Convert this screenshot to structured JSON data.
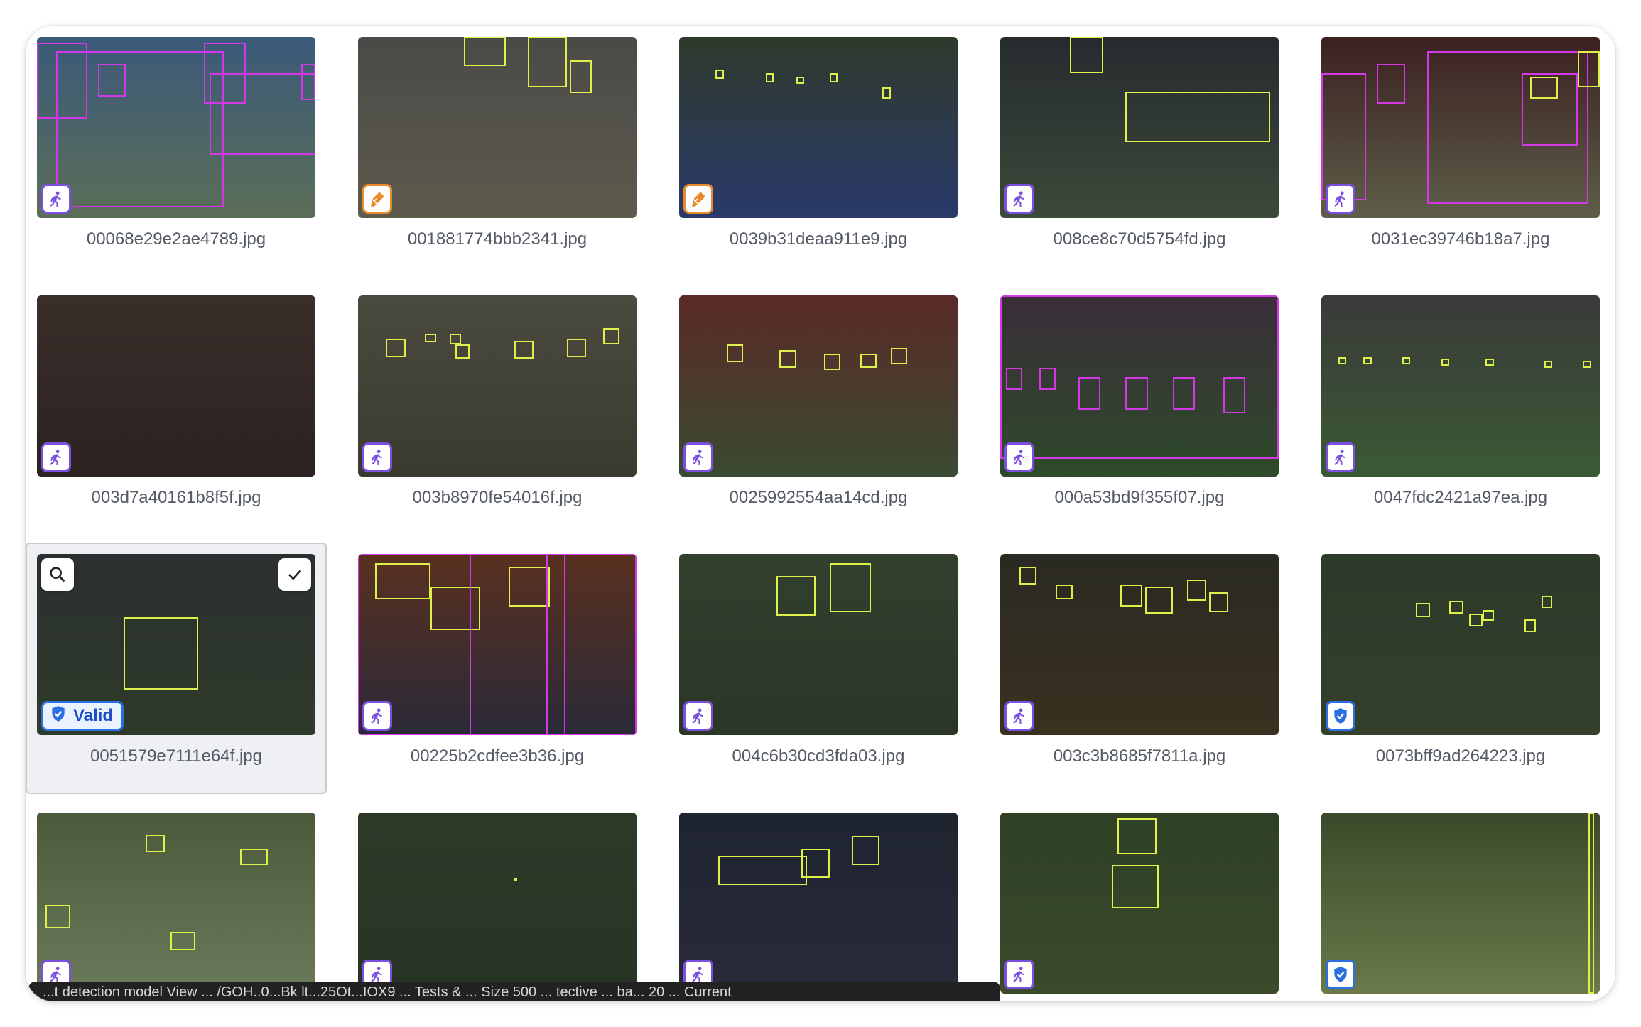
{
  "gallery": {
    "valid_label": "Valid",
    "items": [
      {
        "filename": "00068e29e2ae4789.jpg",
        "badge": "person",
        "status": "purple",
        "bg": [
          "#3b5a7a",
          "#5b6e58"
        ]
      },
      {
        "filename": "001881774bbb2341.jpg",
        "badge": "brush",
        "status": "orange",
        "bg": [
          "#4a4a48",
          "#5d5a4c"
        ]
      },
      {
        "filename": "0039b31deaa911e9.jpg",
        "badge": "brush",
        "status": "orange",
        "bg": [
          "#2f3a2c",
          "#2a3a6a"
        ]
      },
      {
        "filename": "008ce8c70d5754fd.jpg",
        "badge": "person",
        "status": "purple",
        "bg": [
          "#262b2e",
          "#3b4a3a"
        ]
      },
      {
        "filename": "0031ec39746b18a7.jpg",
        "badge": "person",
        "status": "purple",
        "bg": [
          "#3b2020",
          "#5e5e4a"
        ]
      },
      {
        "filename": "003d7a40161b8f5f.jpg",
        "badge": "person",
        "status": "purple",
        "bg": [
          "#3a2e2a",
          "#2b2220"
        ]
      },
      {
        "filename": "003b8970fe54016f.jpg",
        "badge": "person",
        "status": "purple",
        "bg": [
          "#4a4a3e",
          "#3a3a30"
        ]
      },
      {
        "filename": "0025992554aa14cd.jpg",
        "badge": "person",
        "status": "purple",
        "bg": [
          "#5a2a28",
          "#3a4a32"
        ]
      },
      {
        "filename": "000a53bd9f355f07.jpg",
        "badge": "person",
        "status": "purple",
        "bg": [
          "#3a2e3a",
          "#2e4a2a"
        ]
      },
      {
        "filename": "0047fdc2421a97ea.jpg",
        "badge": "person",
        "status": "purple",
        "bg": [
          "#3a3a3a",
          "#3b5a34"
        ]
      },
      {
        "filename": "0051579e7111e64f.jpg",
        "badge": "valid",
        "status": "blue",
        "bg": [
          "#2b3030",
          "#2e3a2a"
        ],
        "selected": true
      },
      {
        "filename": "00225b2cdfee3b36.jpg",
        "badge": "person",
        "status": "purple",
        "bg": [
          "#5a3020",
          "#2a2a38"
        ]
      },
      {
        "filename": "004c6b30cd3fda03.jpg",
        "badge": "person",
        "status": "purple",
        "bg": [
          "#33402e",
          "#2a3626"
        ]
      },
      {
        "filename": "003c3b8685f7811a.jpg",
        "badge": "person",
        "status": "purple",
        "bg": [
          "#2a2a22",
          "#3a3020"
        ]
      },
      {
        "filename": "0073bff9ad264223.jpg",
        "badge": "shield",
        "status": "blue",
        "bg": [
          "#2e3a2a",
          "#34402c"
        ]
      },
      {
        "filename": "",
        "badge": "person",
        "status": "purple",
        "bg": [
          "#4a5a3a",
          "#6a7a5a"
        ]
      },
      {
        "filename": "",
        "badge": "person",
        "status": "purple",
        "bg": [
          "#2e3a28",
          "#283424"
        ]
      },
      {
        "filename": "",
        "badge": "person",
        "status": "purple",
        "bg": [
          "#1e2430",
          "#2a2a3a"
        ]
      },
      {
        "filename": "",
        "badge": "person",
        "status": "purple",
        "bg": [
          "#2e4026",
          "#3a4a2a"
        ]
      },
      {
        "filename": "",
        "badge": "shield",
        "status": "blue",
        "bg": [
          "#3a4a2a",
          "#6a7a4a"
        ]
      }
    ]
  },
  "statusbar": {
    "text": "...t detection model View ... /GOH..0...Bk lt...25Ot...IOX9 ... Tests & ... Size 500 ... tective ... ba... 20 ... Current"
  },
  "colors": {
    "bbox_yellow": "#dff04a",
    "bbox_magenta": "#d437e6",
    "status_purple": "#7b4fe0",
    "status_orange": "#e98b2c",
    "status_blue": "#2b6fe0"
  }
}
